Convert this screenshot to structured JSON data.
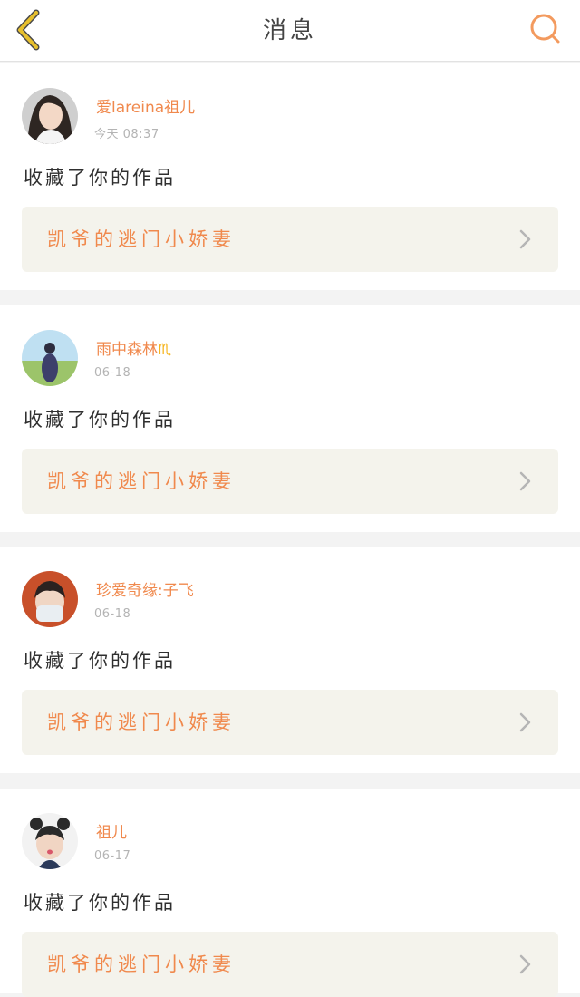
{
  "header": {
    "title": "消息",
    "back_icon": "chevron-left-icon",
    "search_icon": "search-icon",
    "back_color": "#e7c02e",
    "search_color": "#f39a5e"
  },
  "messages": [
    {
      "user_name": "爱lareina祖儿",
      "time": "今天 08:37",
      "action": "收藏了你的作品",
      "work_title": "凯爷的逃门小娇妻"
    },
    {
      "user_name": "雨中森林",
      "badge": "♏",
      "time": "06-18",
      "action": "收藏了你的作品",
      "work_title": "凯爷的逃门小娇妻"
    },
    {
      "user_name": "珍爱奇缘:子飞",
      "time": "06-18",
      "action": "收藏了你的作品",
      "work_title": "凯爷的逃门小娇妻"
    },
    {
      "user_name": "祖儿",
      "time": "06-17",
      "action": "收藏了你的作品",
      "work_title": "凯爷的逃门小娇妻"
    }
  ],
  "colors": {
    "accent": "#f0894d",
    "badge": "#f6b51d",
    "link_bg": "#f4f3ec",
    "page_bg": "#f3f3f3"
  }
}
